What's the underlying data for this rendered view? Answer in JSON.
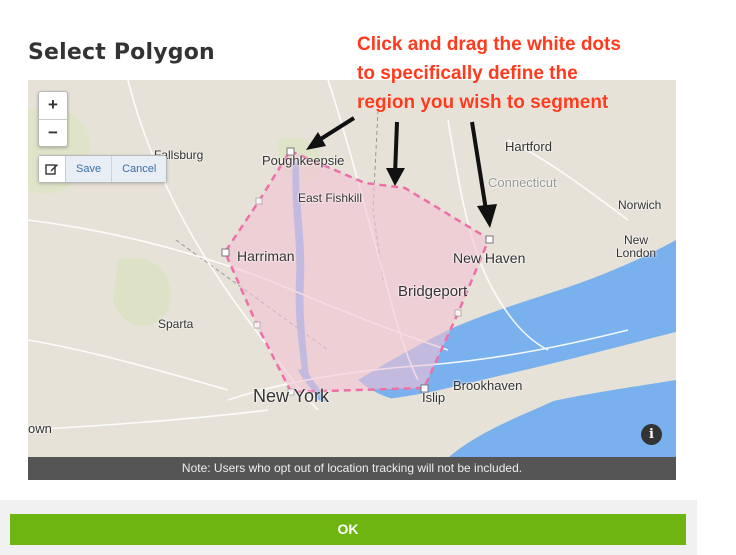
{
  "header": {
    "title": "Select Polygon"
  },
  "annotation": {
    "lines": [
      "Click and drag the white dots",
      "to  specifically define the",
      "region you wish to segment"
    ]
  },
  "toolbar": {
    "zoom_in": "+",
    "zoom_out": "−",
    "save_label": "Save",
    "cancel_label": "Cancel"
  },
  "map": {
    "labels": {
      "fallsburg": "Fallsburg",
      "poughkeepsie": "Poughkeepsie",
      "hartford": "Hartford",
      "connecticut": "Connecticut",
      "east_fishkill": "East Fishkill",
      "norwich": "Norwich",
      "new_london_1": "New",
      "new_london_2": "London",
      "harriman": "Harriman",
      "new_haven": "New Haven",
      "bridgeport": "Bridgeport",
      "sparta": "Sparta",
      "new_york": "New York",
      "brookhaven": "Brookhaven",
      "islip": "Islip",
      "town": "own"
    },
    "info_glyph": "i",
    "note": "Note: Users who opt out of location tracking will not be included."
  },
  "footer": {
    "ok_label": "OK"
  },
  "colors": {
    "water": "#79b0ee",
    "land": "#e7e2d7",
    "polygon_fill": "#f3c3d6",
    "polygon_stroke": "#ee6fa8",
    "accent": "#6fb512",
    "annotation": "#ff3a1d"
  }
}
